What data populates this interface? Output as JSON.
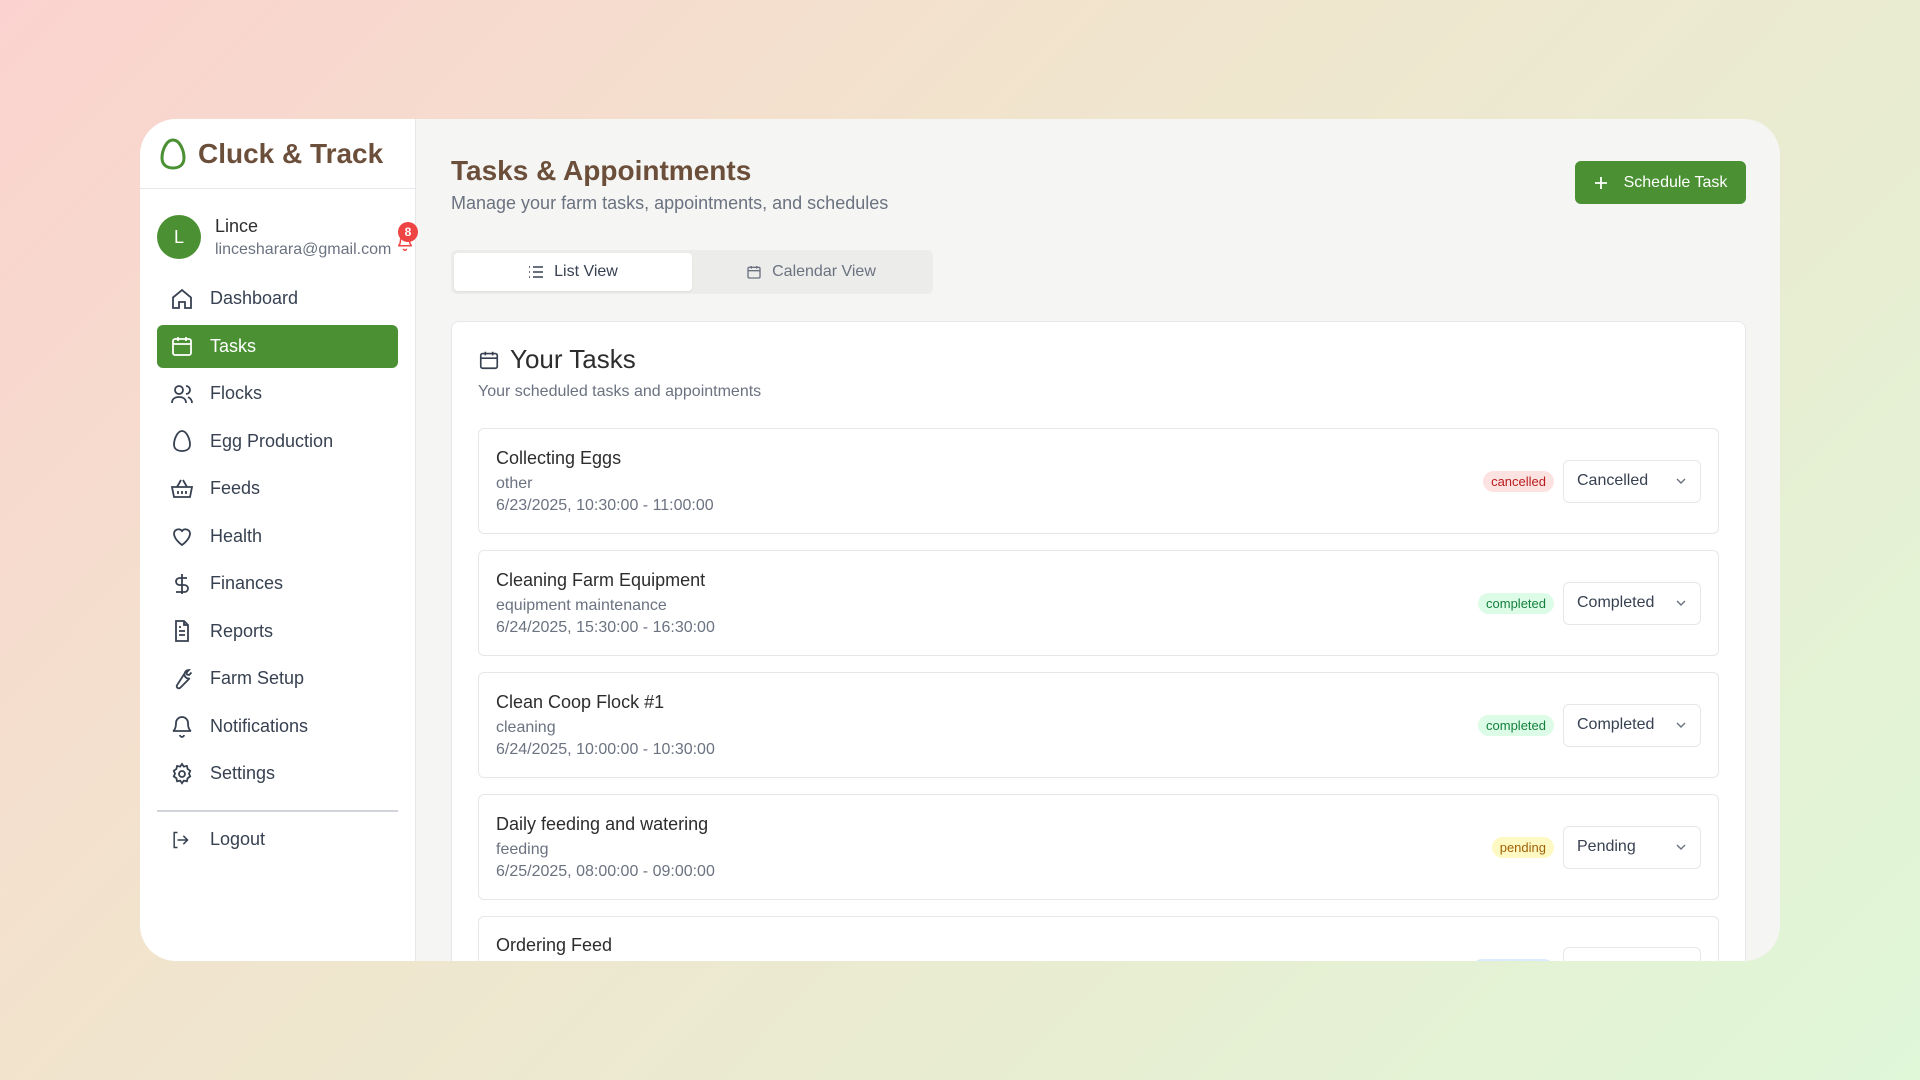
{
  "brand": {
    "name": "Cluck & Track"
  },
  "user": {
    "initial": "L",
    "name": "Lince",
    "email": "lincesharara@gmail.com",
    "notification_count": "8"
  },
  "nav": {
    "items": [
      {
        "label": "Dashboard",
        "icon": "home-icon"
      },
      {
        "label": "Tasks",
        "icon": "calendar-icon",
        "active": true
      },
      {
        "label": "Flocks",
        "icon": "users-icon"
      },
      {
        "label": "Egg Production",
        "icon": "egg-icon"
      },
      {
        "label": "Feeds",
        "icon": "basket-icon"
      },
      {
        "label": "Health",
        "icon": "heart-icon"
      },
      {
        "label": "Finances",
        "icon": "dollar-icon"
      },
      {
        "label": "Reports",
        "icon": "file-text-icon"
      },
      {
        "label": "Farm Setup",
        "icon": "wrench-icon"
      },
      {
        "label": "Notifications",
        "icon": "bell-icon"
      },
      {
        "label": "Settings",
        "icon": "gear-icon"
      }
    ],
    "logout_label": "Logout"
  },
  "header": {
    "title": "Tasks & Appointments",
    "subtitle": "Manage your farm tasks, appointments, and schedules",
    "schedule_button": "Schedule Task"
  },
  "tabs": {
    "list_view": "List View",
    "calendar_view": "Calendar View",
    "active": "list_view"
  },
  "tasks_card": {
    "title": "Your Tasks",
    "subtitle": "Your scheduled tasks and appointments",
    "tasks": [
      {
        "title": "Collecting Eggs",
        "type": "other",
        "time": "6/23/2025, 10:30:00 - 11:00:00",
        "badge": "cancelled",
        "status": "Cancelled"
      },
      {
        "title": "Cleaning Farm Equipment",
        "type": "equipment maintenance",
        "time": "6/24/2025, 15:30:00 - 16:30:00",
        "badge": "completed",
        "status": "Completed"
      },
      {
        "title": "Clean Coop Flock #1",
        "type": "cleaning",
        "time": "6/24/2025, 10:00:00 - 10:30:00",
        "badge": "completed",
        "status": "Completed"
      },
      {
        "title": "Daily feeding and watering",
        "type": "feeding",
        "time": "6/25/2025, 08:00:00 - 09:00:00",
        "badge": "pending",
        "status": "Pending"
      },
      {
        "title": "Ordering Feed",
        "type": "",
        "time": "",
        "badge": "",
        "status": ""
      }
    ]
  },
  "colors": {
    "accent": "#4b9134",
    "brand_text": "#6b4f3a",
    "badge_red": "#ef4444"
  }
}
